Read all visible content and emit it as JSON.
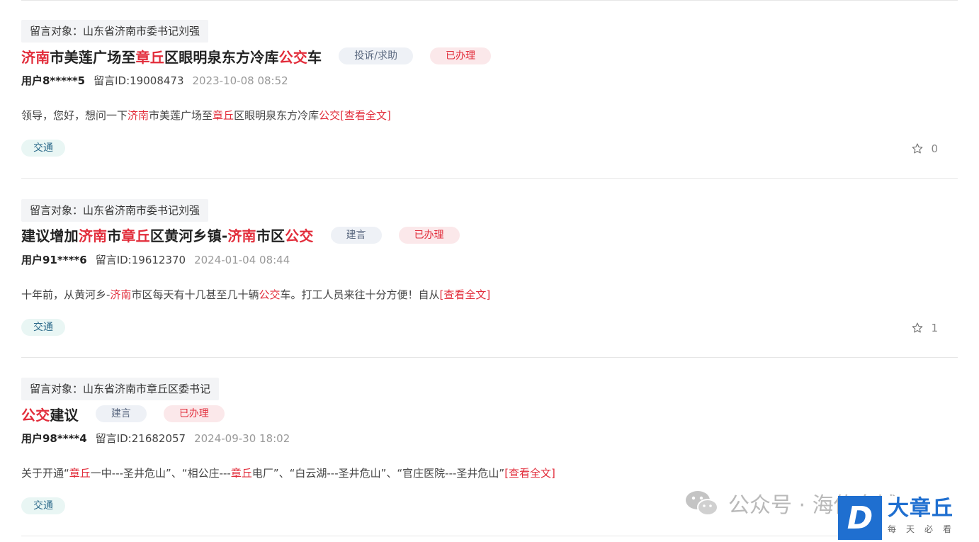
{
  "common": {
    "target_prefix": "留言对象：",
    "id_prefix": "留言ID:",
    "view_full": "[查看全文]"
  },
  "messages": [
    {
      "target": "山东省济南市委书记刘强",
      "title_parts": [
        {
          "text": "济南",
          "hl": true
        },
        {
          "text": "市美莲广场至",
          "hl": false
        },
        {
          "text": "章丘",
          "hl": true
        },
        {
          "text": "区眼明泉东方冷库",
          "hl": false
        },
        {
          "text": "公交",
          "hl": true
        },
        {
          "text": "车",
          "hl": false
        }
      ],
      "type": "投诉/求助",
      "status": "已办理",
      "user": "用户8*****5",
      "id": "19008473",
      "time": "2023-10-08 08:52",
      "summary_parts": [
        {
          "text": "领导，您好，想问一下",
          "hl": false
        },
        {
          "text": "济南",
          "hl": true
        },
        {
          "text": "市美莲广场至",
          "hl": false
        },
        {
          "text": "章丘",
          "hl": true
        },
        {
          "text": "区眼明泉东方冷库",
          "hl": false
        },
        {
          "text": "公交",
          "hl": true
        }
      ],
      "tag": "交通",
      "favorites": "0"
    },
    {
      "target": "山东省济南市委书记刘强",
      "title_parts": [
        {
          "text": "建议增加",
          "hl": false
        },
        {
          "text": "济南",
          "hl": true
        },
        {
          "text": "市",
          "hl": false
        },
        {
          "text": "章丘",
          "hl": true
        },
        {
          "text": "区黄河乡镇-",
          "hl": false
        },
        {
          "text": "济南",
          "hl": true
        },
        {
          "text": "市区",
          "hl": false
        },
        {
          "text": "公交",
          "hl": true
        }
      ],
      "type": "建言",
      "status": "已办理",
      "user": "用户91****6",
      "id": "19612370",
      "time": "2024-01-04 08:44",
      "summary_parts": [
        {
          "text": "十年前，从黄河乡-",
          "hl": false
        },
        {
          "text": "济南",
          "hl": true
        },
        {
          "text": "市区每天有十几甚至几十辆",
          "hl": false
        },
        {
          "text": "公交",
          "hl": true
        },
        {
          "text": "车。打工人员来往十分方便！自从",
          "hl": false
        }
      ],
      "tag": "交通",
      "favorites": "1"
    },
    {
      "target": "山东省济南市章丘区委书记",
      "title_parts": [
        {
          "text": "公交",
          "hl": true
        },
        {
          "text": "建议",
          "hl": false
        }
      ],
      "type": "建言",
      "status": "已办理",
      "user": "用户98****4",
      "id": "21682057",
      "time": "2024-09-30 18:02",
      "summary_parts": [
        {
          "text": "关于开通“",
          "hl": false
        },
        {
          "text": "章丘",
          "hl": true
        },
        {
          "text": "一中---圣井危山”、“相公庄---",
          "hl": false
        },
        {
          "text": "章丘",
          "hl": true
        },
        {
          "text": "电厂”、“白云湖---圣井危山”、“官庄医院---圣井危山”",
          "hl": false
        }
      ],
      "tag": "交通"
    }
  ],
  "watermark": {
    "icon": "wechat-icon",
    "text": "公众号 · 海佑泉城"
  },
  "logo": {
    "letter": "D",
    "name": "大章丘",
    "slogan": "每天必看"
  },
  "colors": {
    "highlight": "#e22d3b",
    "brand_blue": "#1f6fd0"
  }
}
